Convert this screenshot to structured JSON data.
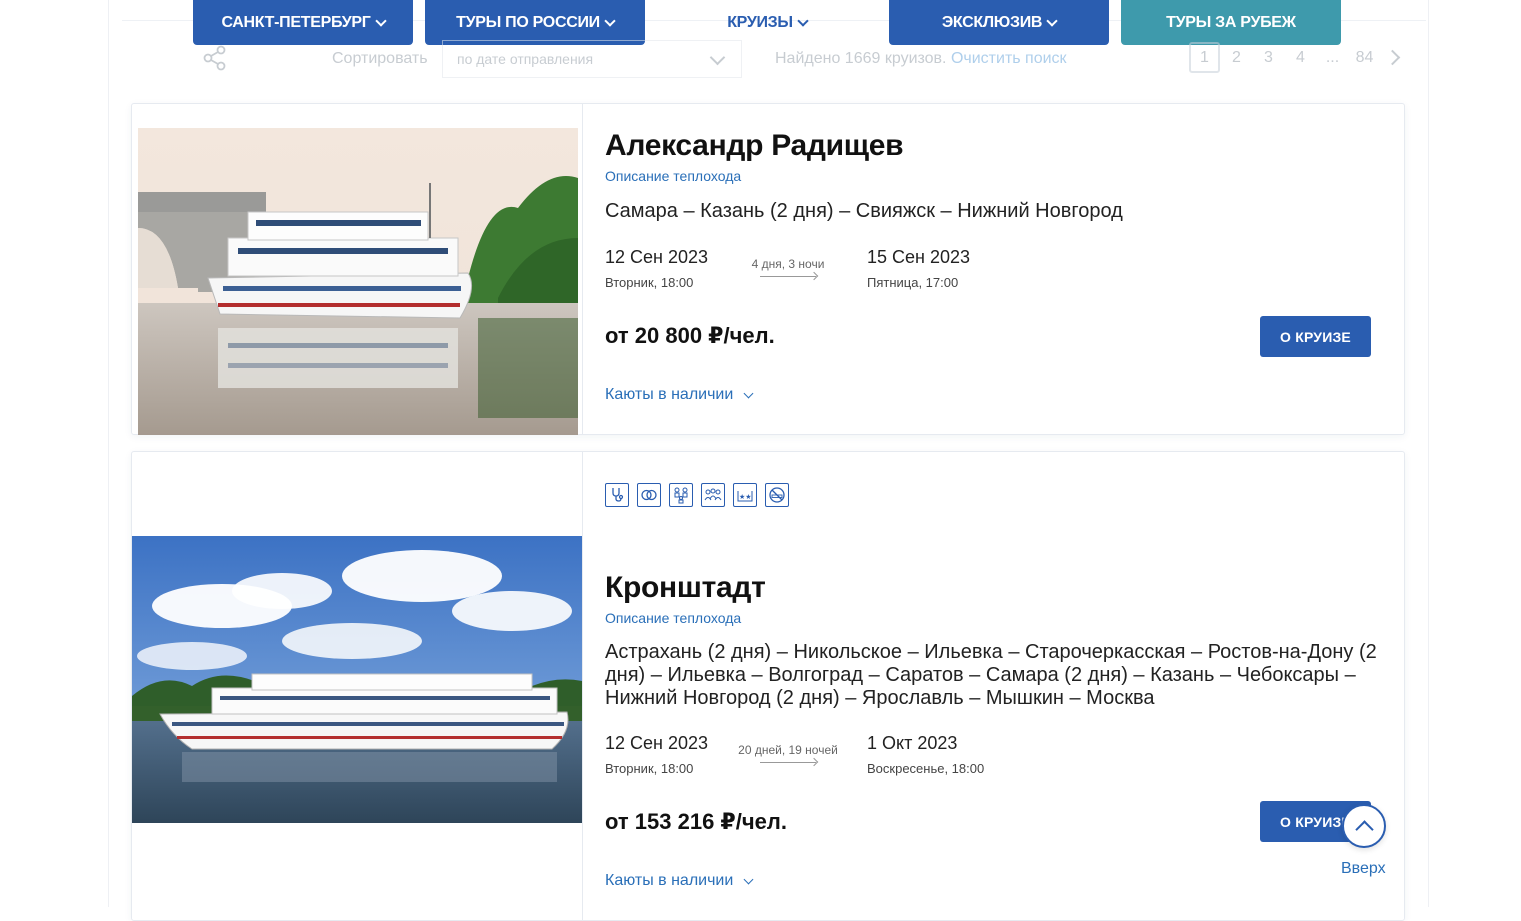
{
  "nav": {
    "tabs": [
      {
        "label": "САНКТ-ПЕТЕРБУРГ",
        "dropdown": true
      },
      {
        "label": "ТУРЫ ПО РОССИИ",
        "dropdown": true
      },
      {
        "label": "КРУИЗЫ",
        "dropdown": true
      },
      {
        "label": "ЭКСКЛЮЗИВ",
        "dropdown": true
      },
      {
        "label": "ТУРЫ ЗА РУБЕЖ",
        "dropdown": false
      }
    ]
  },
  "toolbar": {
    "sort_label": "Сортировать",
    "sort_value": "по дате отправления",
    "found_text": "Найдено 1669 круизов.",
    "clear_link": "Очистить поиск",
    "pages": [
      "1",
      "2",
      "3",
      "4",
      "...",
      "84"
    ],
    "current_page": "1"
  },
  "cruises": [
    {
      "name": "Александр Радищев",
      "description_link": "Описание теплохода",
      "route": "Самара – Казань (2 дня) – Свияжск – Нижний Новгород",
      "start_date": "12 Сен 2023",
      "start_day": "Вторник, 18:00",
      "duration": "4 дня, 3 ночи",
      "end_date": "15 Сен 2023",
      "end_day": "Пятница, 17:00",
      "price": "от 20 800 ₽/чел.",
      "cta": "О КРУИЗЕ",
      "cabins": "Каюты в наличии"
    },
    {
      "name": "Кронштадт",
      "description_link": "Описание теплохода",
      "amenities": [
        "stethoscope-icon",
        "rings-icon",
        "family-icon",
        "group-icon",
        "rating-stars-icon",
        "no-smoking-icon"
      ],
      "route": "Астрахань (2 дня) – Никольское – Ильевка – Старочеркасская – Ростов-на-Дону (2 дня) – Ильевка – Волгоград – Саратов – Самара (2 дня) – Казань – Чебоксары – Нижний Новгород (2 дня) – Ярославль – Мышкин – Москва",
      "start_date": "12 Сен 2023",
      "start_day": "Вторник, 18:00",
      "duration": "20 дней, 19 ночей",
      "end_date": "1 Окт 2023",
      "end_day": "Воскресенье, 18:00",
      "price": "от 153 216 ₽/чел.",
      "cta": "О КРУИЗЕ",
      "cabins": "Каюты в наличии"
    }
  ],
  "scroll_top": {
    "label": "Вверх"
  },
  "colors": {
    "brand_blue": "#2a5db0",
    "teal": "#3e9aac",
    "link_blue": "#2a6fb8"
  }
}
